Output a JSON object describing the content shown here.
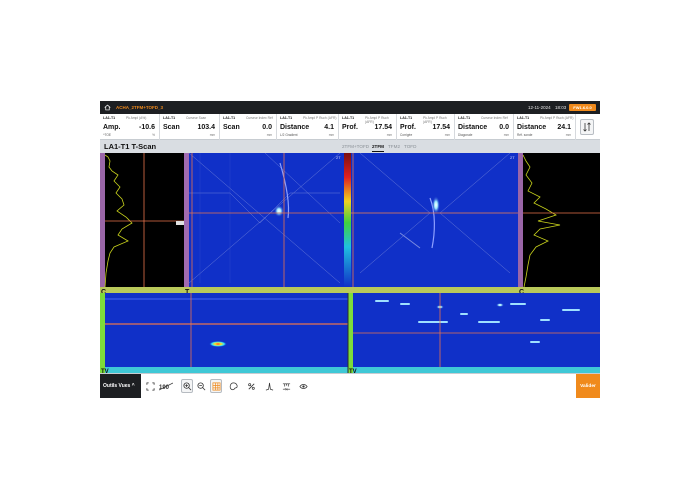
{
  "titlebar": {
    "app_title": "ACHA_2TFM+TOFD_3",
    "date": "12-11-2024",
    "time": "18:03",
    "version_badge": "FW1.6.0.0"
  },
  "readings": [
    {
      "channel": "LA1-T1",
      "source": "Pk Ampl (A%)",
      "label": "Amp.",
      "value": "-10.6",
      "sub": "^TOE",
      "unit": "%"
    },
    {
      "channel": "LA1-T1",
      "source": "Curseur Scan",
      "label": "Scan",
      "value": "103.4",
      "sub": "",
      "unit": "mm"
    },
    {
      "channel": "LA1-T1",
      "source": "Curseur Index Réf",
      "label": "Scan",
      "value": "0.0",
      "sub": "",
      "unit": "mm"
    },
    {
      "channel": "LA1-T1",
      "source": "Pk Ampl P Ruch (AFR)",
      "label": "Distance",
      "value": "4.1",
      "sub": "L/2 Gradient",
      "unit": "mm"
    },
    {
      "channel": "LA1-T1",
      "source": "Pk Ampl P Ruch (AFR)",
      "label": "Prof.",
      "value": "17.54",
      "sub": "",
      "unit": "mm"
    },
    {
      "channel": "LA1-T1",
      "source": "Pk Ampl P Ruch (AFR)",
      "label": "Prof.",
      "value": "17.54",
      "sub": "Corrigée",
      "unit": "mm"
    },
    {
      "channel": "LA1-T1",
      "source": "Curseur Index Réf",
      "label": "Distance",
      "value": "0.0",
      "sub": "Diagonale",
      "unit": "mm"
    },
    {
      "channel": "LA1-T1",
      "source": "Pk Ampl P Ruch (AFR)",
      "label": "Distance",
      "value": "24.1",
      "sub": "Réf. sonde",
      "unit": "mm"
    }
  ],
  "view": {
    "title": "LA1-T1 T-Scan",
    "tabs": [
      {
        "label": "2TFM+TOFD",
        "active": false
      },
      {
        "label": "2TFM",
        "active": true
      },
      {
        "label": "TFM2",
        "active": false
      },
      {
        "label": "TOFD",
        "active": false
      }
    ]
  },
  "panels": {
    "left_letter_top": "C",
    "left_letter_mid": "T",
    "right_letter_mid": "C",
    "bottom_letter_left": "TV",
    "bottom_letter_right": "TV",
    "tfm_corner_label": "2T",
    "tfm_right_corner_label": "2T"
  },
  "toolbar": {
    "outils_label": "Outils Vues",
    "validate_label": "Valider",
    "icons": [
      "fit-screen-icon",
      "dimension-icon",
      "zoom-in-icon",
      "zoom-out-icon",
      "grid-icon",
      "palette-icon",
      "percent-icon",
      "peak-icon",
      "ruler-icon",
      "eye-icon"
    ]
  },
  "colors": {
    "accent": "#f08a1c",
    "titlebar_bg": "#1d1f22",
    "scan_bg": "#1030c8",
    "cursor": "#e8734d",
    "scan_axis_green": "#7ddc3a",
    "scan_axis_cyan": "#3fc8d6"
  }
}
